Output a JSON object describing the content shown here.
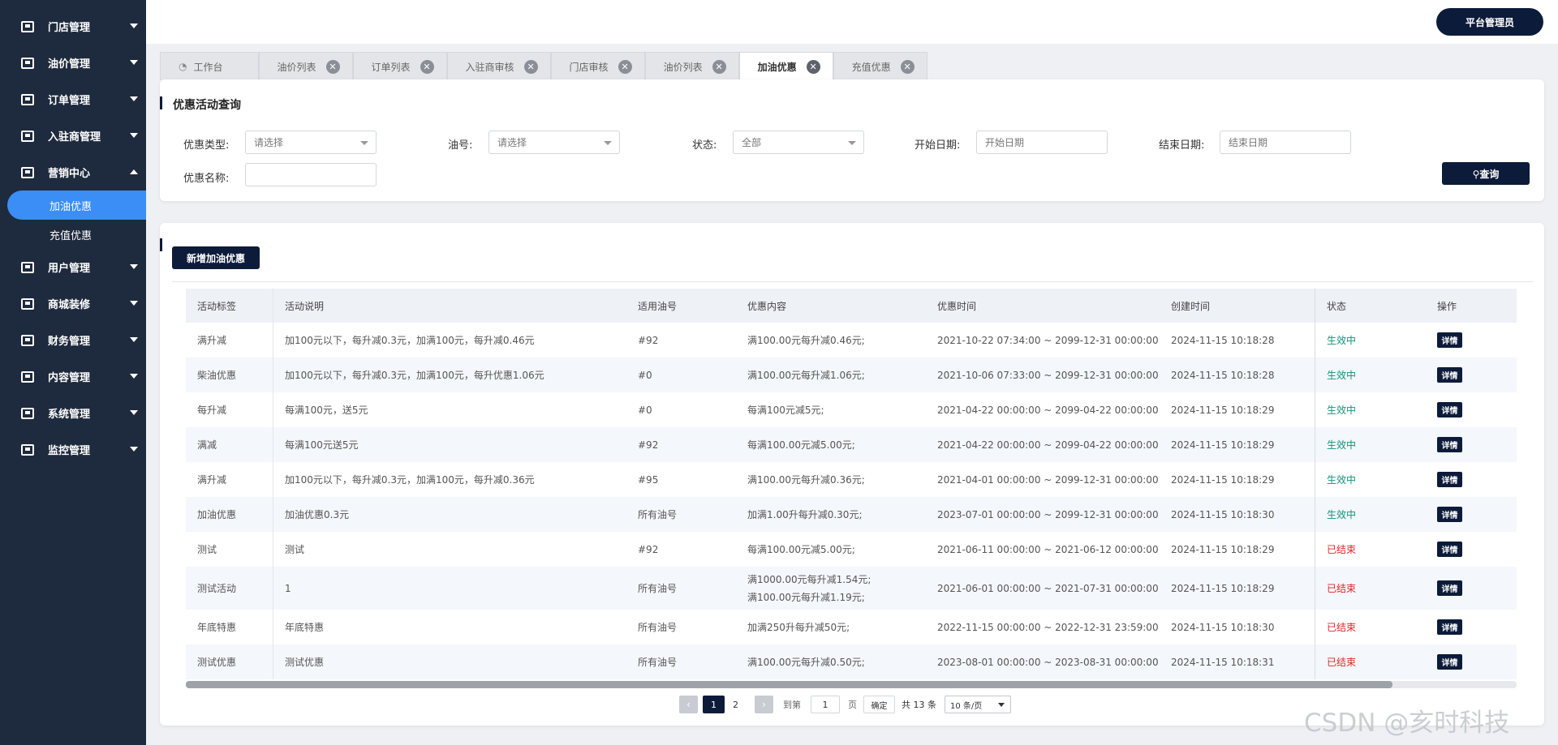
{
  "sidebar": {
    "items": [
      {
        "label": "门店管理",
        "icon": "store-icon"
      },
      {
        "label": "油价管理",
        "icon": "price-icon"
      },
      {
        "label": "订单管理",
        "icon": "order-icon"
      },
      {
        "label": "入驻商管理",
        "icon": "merchant-icon"
      },
      {
        "label": "营销中心",
        "icon": "marketing-icon"
      },
      {
        "label": "用户管理",
        "icon": "user-icon"
      },
      {
        "label": "商城装修",
        "icon": "shop-icon"
      },
      {
        "label": "财务管理",
        "icon": "finance-icon"
      },
      {
        "label": "内容管理",
        "icon": "content-icon"
      },
      {
        "label": "系统管理",
        "icon": "system-icon"
      },
      {
        "label": "监控管理",
        "icon": "monitor-icon"
      }
    ],
    "sub_items": [
      "加油优惠",
      "充值优惠"
    ],
    "active_sub": "加油优惠"
  },
  "header": {
    "admin_label": "平台管理员"
  },
  "tabs": [
    {
      "label": "工作台"
    },
    {
      "label": "油价列表"
    },
    {
      "label": "订单列表"
    },
    {
      "label": "入驻商审核"
    },
    {
      "label": "门店审核"
    },
    {
      "label": "油价列表"
    },
    {
      "label": "加油优惠",
      "active": true
    },
    {
      "label": "充值优惠"
    }
  ],
  "query": {
    "title": "优惠活动查询",
    "type_label": "优惠类型:",
    "type_value": "请选择",
    "oil_label": "油号:",
    "oil_value": "请选择",
    "status_label": "状态:",
    "status_value": "全部",
    "start_label": "开始日期:",
    "start_placeholder": "开始日期",
    "end_label": "结束日期:",
    "end_placeholder": "结束日期",
    "name_label": "优惠名称:",
    "name_value": "",
    "search_label": "查询"
  },
  "list": {
    "add_label": "新增加油优惠",
    "columns": [
      "活动标签",
      "活动说明",
      "适用油号",
      "优惠内容",
      "优惠时间",
      "创建时间",
      "状态",
      "操作"
    ],
    "rows": [
      {
        "tag": "满升减",
        "desc": "加100元以下，每升减0.3元，加满100元，每升减0.46元",
        "oil": "#92",
        "content": "满100.00元每升减0.46元;",
        "time": "2021-10-22 07:34:00 ~ 2099-12-31 00:00:00",
        "created": "2024-11-15 10:18:28",
        "status": "生效中"
      },
      {
        "tag": "柴油优惠",
        "desc": "加100元以下，每升减0.3元，加满100元，每升优惠1.06元",
        "oil": "#0",
        "content": "满100.00元每升减1.06元;",
        "time": "2021-10-06 07:33:00 ~ 2099-12-31 00:00:00",
        "created": "2024-11-15 10:18:28",
        "status": "生效中"
      },
      {
        "tag": "每升减",
        "desc": "每满100元，送5元",
        "oil": "#0",
        "content": "每满100元减5元;",
        "time": "2021-04-22 00:00:00 ~ 2099-04-22 00:00:00",
        "created": "2024-11-15 10:18:29",
        "status": "生效中"
      },
      {
        "tag": "满减",
        "desc": "每满100元送5元",
        "oil": "#92",
        "content": "每满100.00元减5.00元;",
        "time": "2021-04-22 00:00:00 ~ 2099-04-22 00:00:00",
        "created": "2024-11-15 10:18:29",
        "status": "生效中"
      },
      {
        "tag": "满升减",
        "desc": "加100元以下，每升减0.3元，加满100元，每升减0.36元",
        "oil": "#95",
        "content": "满100.00元每升减0.36元;",
        "time": "2021-04-01 00:00:00 ~ 2099-12-31 00:00:00",
        "created": "2024-11-15 10:18:29",
        "status": "生效中"
      },
      {
        "tag": "加油优惠",
        "desc": "加油优惠0.3元",
        "oil": "所有油号",
        "content": "加满1.00升每升减0.30元;",
        "time": "2023-07-01 00:00:00 ~ 2099-12-31 00:00:00",
        "created": "2024-11-15 10:18:30",
        "status": "生效中"
      },
      {
        "tag": "测试",
        "desc": "测试",
        "oil": "#92",
        "content": "每满100.00元减5.00元;",
        "time": "2021-06-11 00:00:00 ~ 2021-06-12 00:00:00",
        "created": "2024-11-15 10:18:29",
        "status": "已结束"
      },
      {
        "tag": "测试活动",
        "desc": "1",
        "oil": "所有油号",
        "content": "满1000.00元每升减1.54元;",
        "content2": "满100.00元每升减1.19元;",
        "time": "2021-06-01 00:00:00 ~ 2021-07-31 00:00:00",
        "created": "2024-11-15 10:18:29",
        "status": "已结束"
      },
      {
        "tag": "年底特惠",
        "desc": "年底特惠",
        "oil": "所有油号",
        "content": "加满250升每升减50元;",
        "time": "2022-11-15 00:00:00 ~ 2022-12-31 23:59:00",
        "created": "2024-11-15 10:18:30",
        "status": "已结束"
      },
      {
        "tag": "测试优惠",
        "desc": "测试优惠",
        "oil": "所有油号",
        "content": "满100.00元每升减0.50元;",
        "time": "2023-08-01 00:00:00 ~ 2023-08-31 00:00:00",
        "created": "2024-11-15 10:18:31",
        "status": "已结束"
      }
    ],
    "detail_label": "详情"
  },
  "pager": {
    "pages": [
      "1",
      "2"
    ],
    "current": "1",
    "goto_label": "到第",
    "goto_value": "1",
    "page_unit": "页",
    "confirm_label": "确定",
    "total_label": "共 13 条",
    "size_label": "10 条/页"
  },
  "watermark": "CSDN @亥时科技",
  "colors": {
    "sidebar_bg": "#1e2a3d",
    "accent": "#0d1b3a",
    "active_blue": "#3a8ef6",
    "status_ok": "#12937b",
    "status_end": "#e0262b"
  }
}
